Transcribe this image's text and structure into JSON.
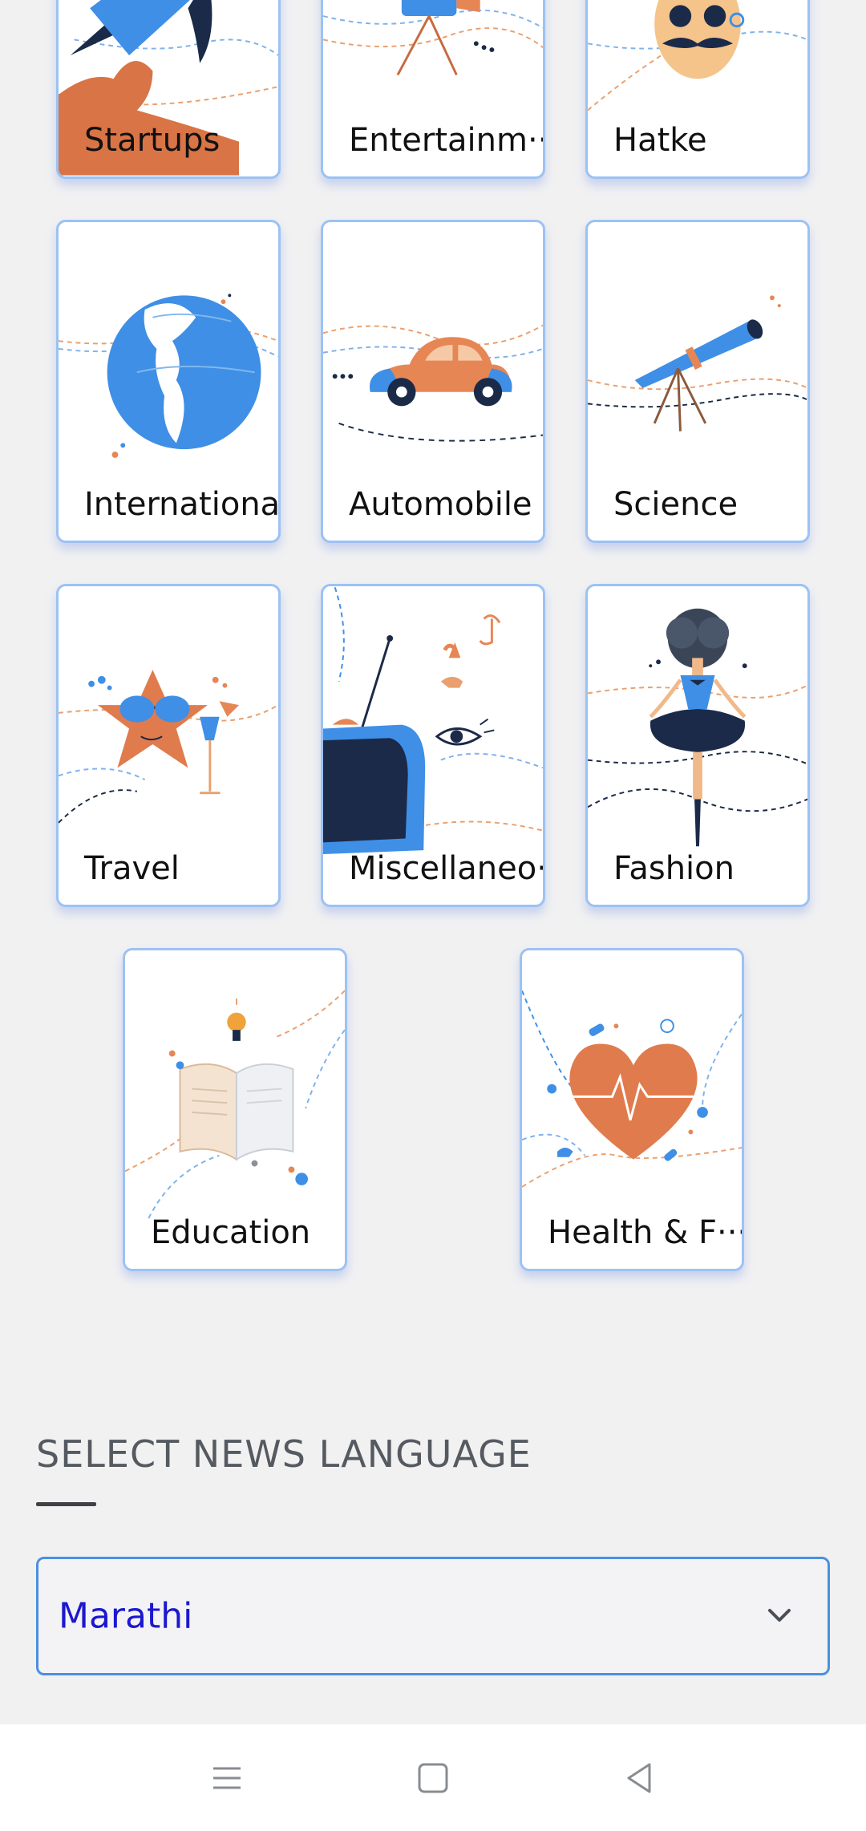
{
  "categories": [
    {
      "label": "Startups",
      "icon": "rocket-icon"
    },
    {
      "label": "Entertainm···",
      "icon": "movie-camera-icon"
    },
    {
      "label": "Hatke",
      "icon": "mustache-face-icon"
    },
    {
      "label": "International",
      "icon": "globe-icon"
    },
    {
      "label": "Automobile",
      "icon": "car-icon"
    },
    {
      "label": "Science",
      "icon": "telescope-icon"
    },
    {
      "label": "Travel",
      "icon": "starfish-sunglasses-icon"
    },
    {
      "label": "Miscellaneo···",
      "icon": "tv-music-eye-icon"
    },
    {
      "label": "Fashion",
      "icon": "dancer-icon"
    },
    {
      "label": "Education",
      "icon": "open-book-icon"
    },
    {
      "label": "Health & F···",
      "icon": "heart-pulse-icon"
    }
  ],
  "language_section": {
    "title": "SELECT NEWS LANGUAGE",
    "selected": "Marathi"
  },
  "colors": {
    "accent_blue": "#3f8fe6",
    "accent_orange": "#e78655",
    "navy": "#1b2a48",
    "card_border": "#9cc2f3",
    "select_text": "#1c18cf"
  },
  "navbar": [
    "menu-icon",
    "home-icon",
    "back-icon"
  ]
}
